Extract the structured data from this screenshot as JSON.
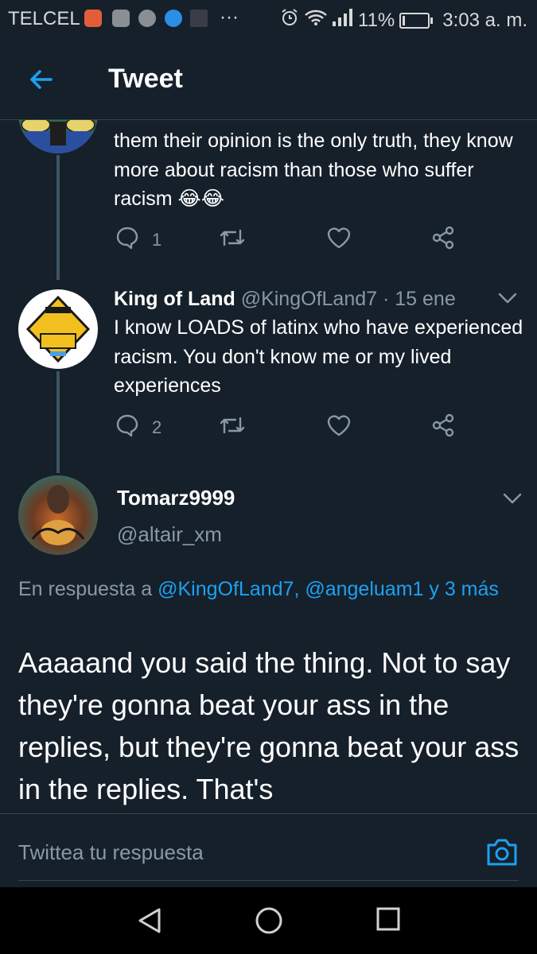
{
  "status_bar": {
    "carrier": "TELCEL",
    "more_indicator": "···",
    "battery_percent": "11%",
    "battery_level": 0.11,
    "time": "3:03 a. m.",
    "icons": [
      "notification-app-icon",
      "gallery-icon",
      "check-icon",
      "messenger-icon",
      "image-thumbnail-icon",
      "alarm-icon",
      "wifi-icon",
      "signal-icon",
      "battery-icon"
    ]
  },
  "header": {
    "title": "Tweet",
    "back_icon": "arrow-left-icon"
  },
  "tweets": [
    {
      "text": "them their opinion is the only truth, they know more about racism than those who suffer racism 😂😂",
      "reply_count": "1"
    },
    {
      "display_name": "King of Land",
      "handle": "@KingOfLand7",
      "date": "· 15 ene",
      "text": "I know LOADS of latinx who have experienced racism. You don't know me or my lived experiences",
      "reply_count": "2"
    }
  ],
  "focused_tweet": {
    "display_name": "Tomarz9999",
    "handle": "@altair_xm",
    "reply_prefix": "En respuesta a",
    "reply_targets": "@KingOfLand7, @angeluam1 y 3 más",
    "text": "Aaaaand you said the thing. Not to say they're gonna beat your ass in the replies, but they're gonna beat your ass in the replies. That's"
  },
  "compose": {
    "placeholder": "Twittea tu respuesta",
    "camera_icon": "camera-icon"
  },
  "nav_bar": {
    "buttons": [
      "back-triangle-icon",
      "home-circle-icon",
      "recents-square-icon"
    ]
  },
  "colors": {
    "background": "#15202b",
    "accent": "#1da1f2",
    "secondary_text": "#8899a6",
    "divider": "#38444d"
  }
}
